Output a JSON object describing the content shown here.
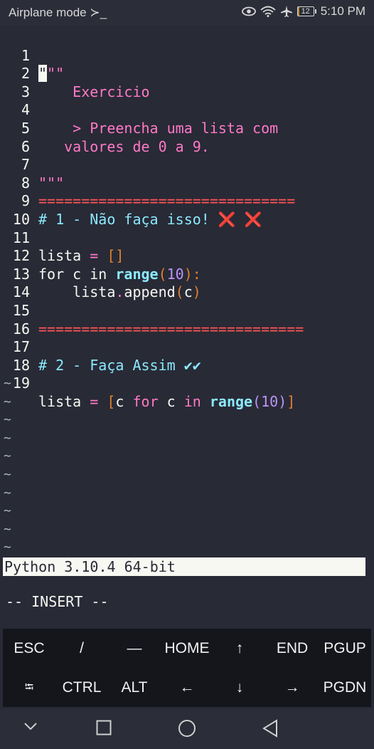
{
  "status_bar": {
    "left_text": "Airplane mode ≻_",
    "battery_level": "12",
    "time": "5:10 PM",
    "icons": [
      "eye-icon",
      "wifi-icon",
      "airplane-icon",
      "battery-icon"
    ]
  },
  "editor": {
    "line_numbers": [
      "1",
      "2",
      "3",
      "4",
      "5",
      "6",
      "7",
      "8",
      "9",
      "10",
      "11",
      "12",
      "13",
      "14",
      "15",
      "16",
      "17",
      "18",
      "19"
    ],
    "lines": {
      "l1_cursor": "\"",
      "l1_rest": "\"\"",
      "l2": "    Exercicio",
      "l4": "    > Preencha uma lista com",
      "l5": "   valores de 0 a 9.",
      "l7": "\"\"\"",
      "l8": "==============================",
      "l9": "# 1 - Não faça isso! ❌ ❌",
      "l11_a": "lista ",
      "l11_op": "=",
      "l11_br": " []",
      "l12_kw": "for c in ",
      "l12_fn": "range",
      "l12_p1": "(",
      "l12_num": "10",
      "l12_p2": "):",
      "l13_a": "    lista",
      "l13_dot": ".",
      "l13_fn": "append",
      "l13_p1": "(",
      "l13_arg": "c",
      "l13_p2": ")",
      "l15": "===============================",
      "l17": "# 2 - Faça Assim ✔✔",
      "l19_a": "lista ",
      "l19_op": "=",
      "l19_b1": " [",
      "l19_c": "c ",
      "l19_for": "for",
      "l19_c2": " c ",
      "l19_in": "in",
      "l19_sp": " ",
      "l19_fn": "range",
      "l19_p1": "(",
      "l19_num": "10",
      "l19_p2": ")",
      "l19_b2": "]"
    },
    "tilde": "~"
  },
  "python_status": "Python 3.10.4 64-bit",
  "mode_text": "-- INSERT --",
  "extra_keys": {
    "row1": [
      "ESC",
      "/",
      "—",
      "HOME",
      "↑",
      "END",
      "PGUP"
    ],
    "row2": [
      "⭾",
      "CTRL",
      "ALT",
      "←",
      "↓",
      "→",
      "PGDN"
    ]
  },
  "navbar": [
    "chevron-down-icon",
    "square-icon",
    "circle-icon",
    "back-triangle-icon"
  ],
  "colors": {
    "background": "#282a36",
    "pink": "#ff79c6",
    "red": "#ff5555",
    "cyan": "#8be9fd",
    "purple": "#bd93f9",
    "orange": "#e0802e"
  }
}
